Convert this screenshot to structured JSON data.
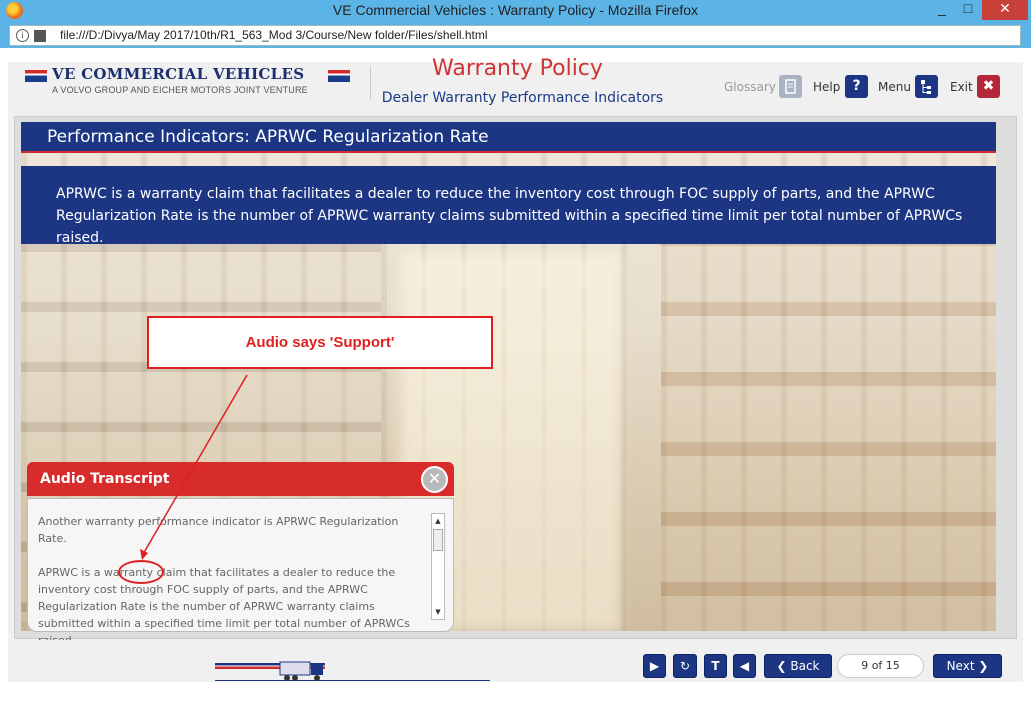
{
  "window": {
    "title": "VE Commercial Vehicles : Warranty Policy - Mozilla Firefox",
    "url": "file:///D:/Divya/May 2017/10th/R1_563_Mod 3/Course/New folder/Files/shell.html",
    "minimize": "_",
    "maximize": "□",
    "close": "✕"
  },
  "header": {
    "brand_name": "VE COMMERCIAL VEHICLES",
    "brand_sub": "A VOLVO GROUP AND EICHER MOTORS JOINT VENTURE",
    "course_title": "Warranty Policy",
    "course_subtitle": "Dealer Warranty Performance Indicators",
    "nav": {
      "glossary": "Glossary",
      "help": "Help",
      "menu": "Menu",
      "exit": "Exit"
    }
  },
  "slide": {
    "title": "Performance Indicators: APRWC Regularization Rate",
    "banner": "APRWC is a warranty claim that facilitates a dealer to reduce the inventory cost through FOC supply of parts, and the APRWC Regularization Rate is the number of APRWC warranty claims submitted within a specified time limit per total number of APRWCs raised."
  },
  "callout": {
    "text": "Audio says 'Support'"
  },
  "transcript": {
    "heading": "Audio Transcript",
    "close": "✕",
    "paragraph1": "Another warranty performance indicator is APRWC Regularization Rate.",
    "paragraph2": "APRWC is a warranty claim that facilitates a dealer to reduce the inventory cost through FOC supply of parts, and the APRWC Regularization Rate is the number of APRWC warranty claims submitted within a specified time limit per total number of APRWCs raised.",
    "scroll_up": "▲",
    "scroll_down": "▼"
  },
  "footer": {
    "play": "▶",
    "replay": "↻",
    "text": "T",
    "audio": "◀",
    "back": "❮ Back",
    "pager": "9 of 15",
    "next": "Next ❯"
  },
  "colors": {
    "brand_blue": "#1c3684",
    "brand_red": "#d22a2a",
    "callout_red": "#e02020"
  }
}
